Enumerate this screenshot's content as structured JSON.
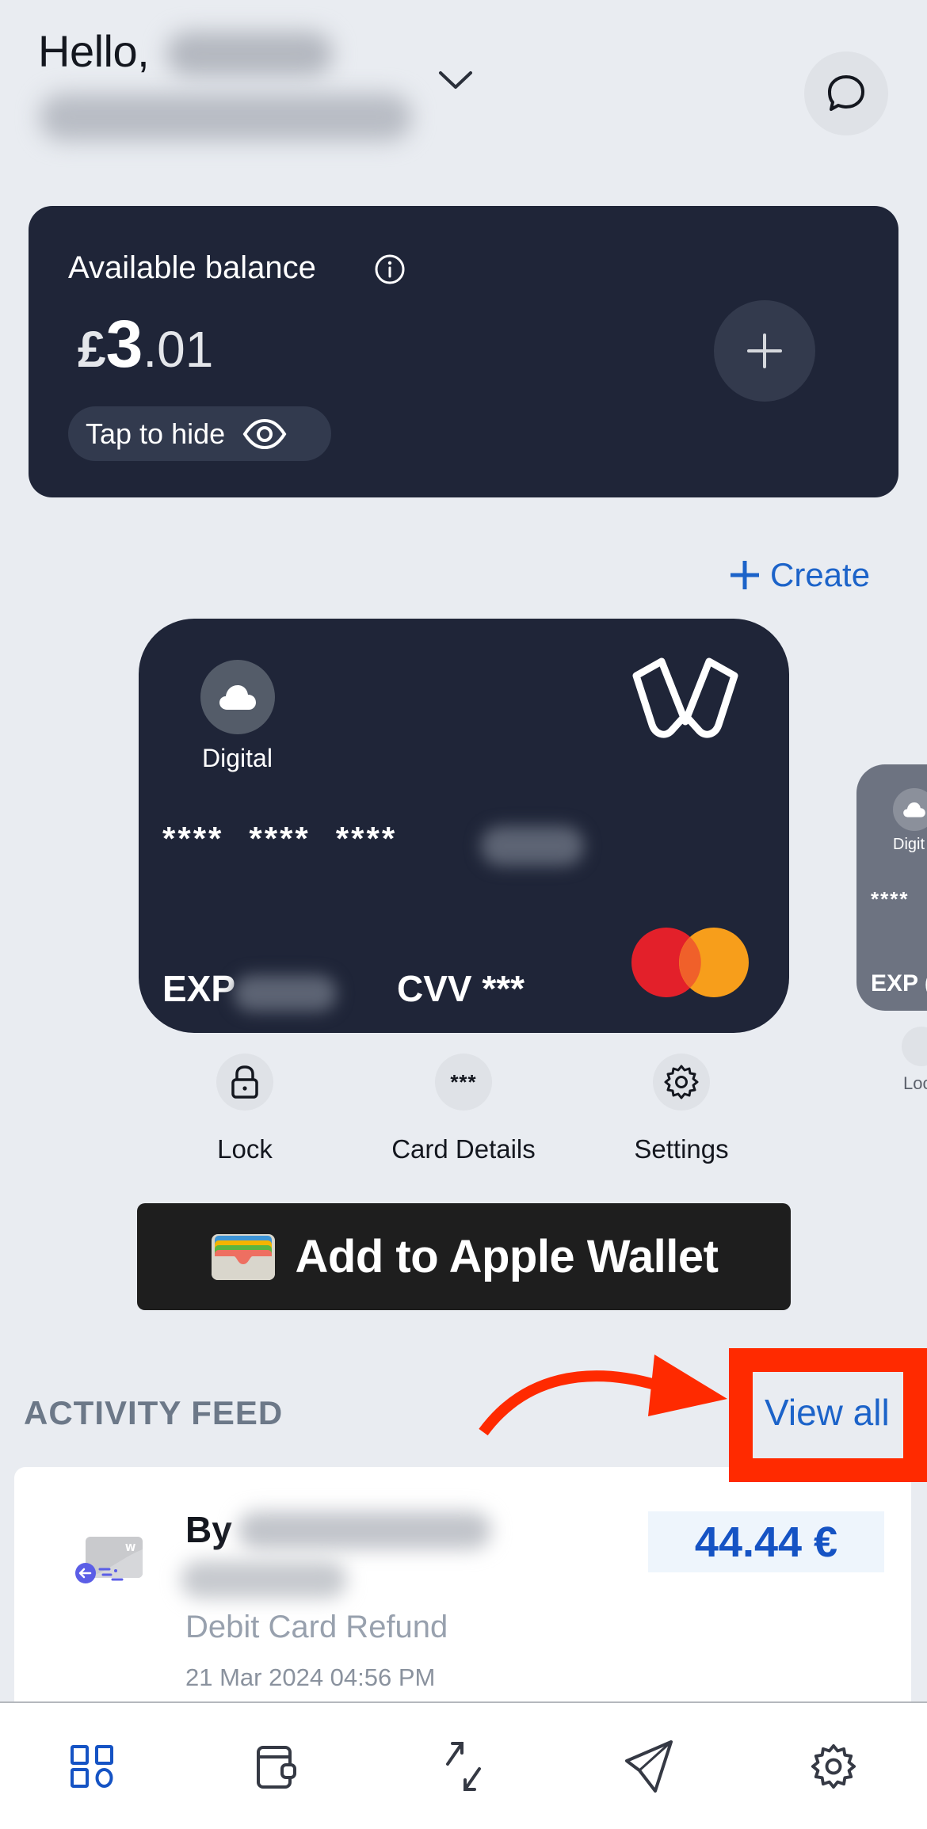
{
  "header": {
    "greeting": "Hello,",
    "account_name_redacted": true,
    "chevron_icon": "chevron-down-icon",
    "chat_icon": "chat-bubble-icon"
  },
  "balance": {
    "label": "Available balance",
    "currency_symbol": "£",
    "integer_part": "3",
    "decimal_part": ".01",
    "hide_toggle_label": "Tap to hide",
    "info_icon": "info-icon",
    "eye_icon": "eye-icon",
    "add_icon": "plus-icon"
  },
  "cards": {
    "create_label": "Create",
    "primary": {
      "type_label": "Digital",
      "number_groups": [
        "****",
        "****",
        "****"
      ],
      "last_four_redacted": true,
      "exp_label": "EXP",
      "cvv_label": "CVV ***",
      "network": "mastercard",
      "colors": {
        "background": "#1f2538",
        "mc_red": "#e3202a",
        "mc_orange": "#f79e1b",
        "mc_overlap": "#f0602a"
      }
    },
    "secondary_peek": {
      "type_label": "Digit",
      "number": "****",
      "exp_label": "EXP (",
      "action_label": "Loc"
    },
    "actions": [
      {
        "label": "Lock",
        "icon": "lock-icon"
      },
      {
        "label": "Card Details",
        "icon": "masked-digits-icon",
        "glyph": "***"
      },
      {
        "label": "Settings",
        "icon": "gear-icon"
      }
    ],
    "wallet_button_label": "Add to Apple Wallet"
  },
  "activity": {
    "title": "ACTIVITY FEED",
    "view_all_label": "View all",
    "annotation_color": "#ff2a00",
    "items": [
      {
        "by_prefix": "By",
        "merchant_redacted": true,
        "type": "Debit Card Refund",
        "datetime": "21 Mar 2024 04:56 PM",
        "amount": "44.44 €"
      }
    ]
  },
  "bottom_nav": {
    "active_index": 0,
    "active_color": "#1553c4",
    "items": [
      {
        "icon": "dashboard-grid-icon"
      },
      {
        "icon": "wallet-icon"
      },
      {
        "icon": "transfer-arrows-icon"
      },
      {
        "icon": "send-icon"
      },
      {
        "icon": "gear-icon"
      }
    ]
  },
  "theme": {
    "background": "#e9ecf1",
    "card_dark": "#1f2538",
    "link_blue": "#1c63c9"
  }
}
